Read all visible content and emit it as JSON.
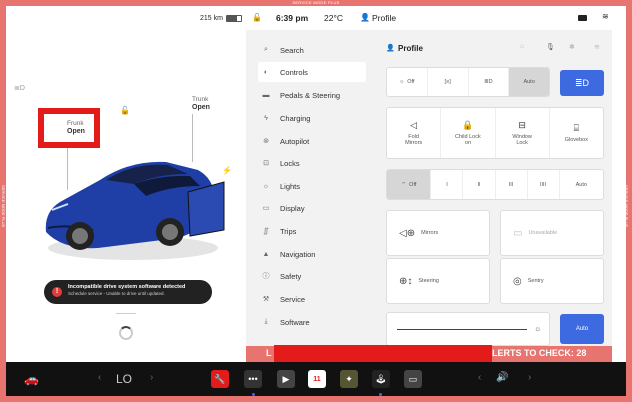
{
  "service_mode_label": "SERVICE MODE PLUS",
  "service_mode_side": "SERVICE MODE PLUS",
  "status": {
    "range": "215 km",
    "time": "6:39 pm",
    "temperature": "22°C",
    "profile": "Profile"
  },
  "car": {
    "frunk_label": "Frunk",
    "frunk_value": "Open",
    "trunk_label": "Trunk",
    "trunk_value": "Open",
    "body_color": "#1f3fa6"
  },
  "alert": {
    "title": "Incompatible drive system software detected",
    "subtitle": "Schedule service - Unable to drive until updated."
  },
  "nav": {
    "items": [
      {
        "label": "Search",
        "icon": "search-icon"
      },
      {
        "label": "Controls",
        "icon": "toggle-icon"
      },
      {
        "label": "Pedals & Steering",
        "icon": "car-icon"
      },
      {
        "label": "Charging",
        "icon": "bolt-icon"
      },
      {
        "label": "Autopilot",
        "icon": "steering-icon"
      },
      {
        "label": "Locks",
        "icon": "lock-icon"
      },
      {
        "label": "Lights",
        "icon": "sun-icon"
      },
      {
        "label": "Display",
        "icon": "display-icon"
      },
      {
        "label": "Trips",
        "icon": "trips-icon"
      },
      {
        "label": "Navigation",
        "icon": "navigation-icon"
      },
      {
        "label": "Safety",
        "icon": "safety-icon"
      },
      {
        "label": "Service",
        "icon": "wrench-icon"
      },
      {
        "label": "Software",
        "icon": "download-icon"
      }
    ],
    "active_index": 1
  },
  "controls": {
    "profile_label": "Profile",
    "lights": [
      "Off",
      "",
      "",
      "Auto"
    ],
    "lights_selected": 3,
    "quick": [
      {
        "label": "Fold\nMirrors"
      },
      {
        "label": "Child Lock\non"
      },
      {
        "label": "Window\nLock"
      },
      {
        "label": "Glovebox"
      }
    ],
    "wipers": [
      "Off",
      "I",
      "II",
      "III",
      "IIII",
      "Auto"
    ],
    "wipers_selected": 0,
    "mirrors": "Mirrors",
    "unavailable": "Unavailable",
    "steering": "Steering",
    "sentry": "Sentry",
    "auto_brightness": "Auto"
  },
  "bottom": {
    "alerts_left": "L",
    "alerts_right": "LERTS TO CHECK: 28",
    "calendar_day": "11",
    "temp_left": "LO"
  },
  "colors": {
    "accent": "#3e6ae1",
    "service_frame": "#e8746f",
    "redaction": "#e41b1b"
  }
}
